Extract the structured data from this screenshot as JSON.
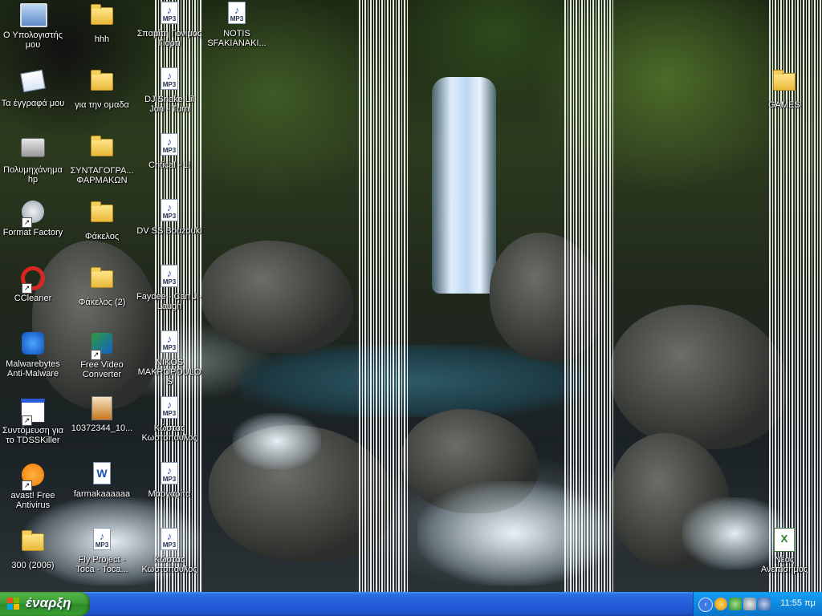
{
  "desktop_icons": {
    "col1": [
      {
        "label": "Ο Υπολογιστής μου"
      },
      {
        "label": "Τα έγγραφά μου"
      },
      {
        "label": "Πολυμηχάνημα hp"
      },
      {
        "label": "Format Factory"
      },
      {
        "label": "CCleaner"
      },
      {
        "label": "Malwarebytes Anti-Malware"
      },
      {
        "label": "Συντόμευση για το TDSSKiller"
      },
      {
        "label": "avast! Free Antivirus"
      },
      {
        "label": "300 (2006)"
      }
    ],
    "col2": [
      {
        "label": "hhh"
      },
      {
        "label": "για την ομαδα"
      },
      {
        "label": "ΣΥΝΤΑΓΟΓΡΑ... ΦΑΡΜΑΚΩΝ"
      },
      {
        "label": "Φάκελος"
      },
      {
        "label": "Φάκελος (2)"
      },
      {
        "label": "Free Video Converter"
      },
      {
        "label": "10372344_10..."
      },
      {
        "label": "farmakaaaaaa"
      },
      {
        "label": "Fly Project - Toca - Toca..."
      }
    ],
    "col3": [
      {
        "label": "Σπαμίτη Γονίμος Γιορτι"
      },
      {
        "label": "DJ Snake Lil Jon - Turn"
      },
      {
        "label": "Critical - Li"
      },
      {
        "label": "DV SS Bouzouki"
      },
      {
        "label": "Faydee - Can J - Laugh"
      },
      {
        "label": "NIKOS MAKROPOULOS"
      },
      {
        "label": "Κώστας Κωστοπουλος"
      },
      {
        "label": "Μαργαρίτα"
      },
      {
        "label": "Κώστας Κωστοπουλος"
      }
    ],
    "col4": [
      {
        "label": "NOTIS SFAKIANAKI..."
      }
    ],
    "right": [
      {
        "label": "GAMES"
      },
      {
        "label": "Νέος Ανεπίσημος"
      }
    ]
  },
  "taskbar": {
    "start_label": "έναρξη",
    "clock": "11:55 πμ",
    "chevron": "‹"
  },
  "colors": {
    "taskbar_blue": "#245edb",
    "start_green": "#3c9f32",
    "tray_blue": "#0f8ae0"
  }
}
